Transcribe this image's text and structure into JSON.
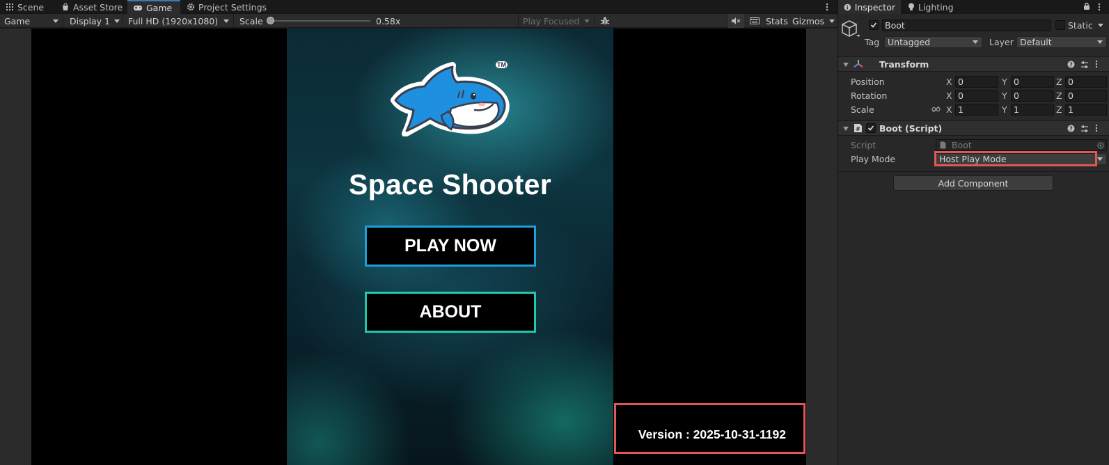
{
  "editor_tabs": [
    {
      "label": "Scene",
      "icon": "grid-icon"
    },
    {
      "label": "Asset Store",
      "icon": "bag-icon"
    },
    {
      "label": "Game",
      "icon": "gamepad-icon"
    },
    {
      "label": "Project Settings",
      "icon": "gear-icon"
    }
  ],
  "game_toolbar": {
    "display_mode": "Game",
    "display": "Display 1",
    "resolution": "Full HD (1920x1080)",
    "scale_label": "Scale",
    "scale_value": "0.58x",
    "play_mode": "Play Focused",
    "stats": "Stats",
    "gizmos": "Gizmos"
  },
  "game": {
    "title": "Space Shooter",
    "tm": "TM",
    "play_button": "PLAY NOW",
    "about_button": "ABOUT",
    "version": "Version : 2025-10-31-1192"
  },
  "inspector": {
    "tabs": [
      {
        "label": "Inspector",
        "icon": "info-icon"
      },
      {
        "label": "Lighting",
        "icon": "bulb-icon"
      }
    ],
    "object_name": "Boot",
    "static_label": "Static",
    "tag_label": "Tag",
    "tag_value": "Untagged",
    "layer_label": "Layer",
    "layer_value": "Default",
    "transform": {
      "title": "Transform",
      "rows": [
        {
          "label": "Position",
          "x": "0",
          "y": "0",
          "z": "0"
        },
        {
          "label": "Rotation",
          "x": "0",
          "y": "0",
          "z": "0"
        },
        {
          "label": "Scale",
          "x": "1",
          "y": "1",
          "z": "1"
        }
      ]
    },
    "script_component": {
      "title": "Boot (Script)",
      "script_label": "Script",
      "script_value": "Boot",
      "play_mode_label": "Play Mode",
      "play_mode_value": "Host Play Mode"
    },
    "add_component": "Add Component"
  },
  "colors": {
    "highlight": "#e35656",
    "play_border": "#1e9fd8",
    "about_border": "#22c9a8",
    "active_tab_accent": "#3a79bb"
  }
}
